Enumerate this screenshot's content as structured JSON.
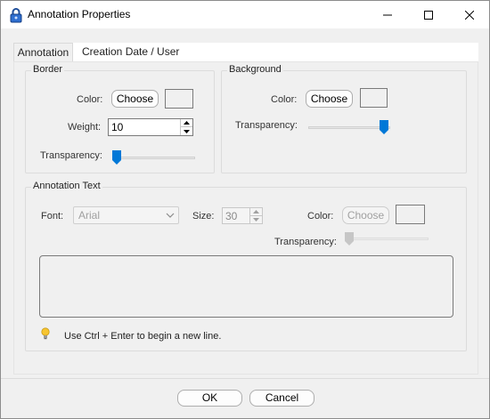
{
  "window": {
    "title": "Annotation Properties",
    "controls": {
      "minimize": "minimize",
      "maximize": "maximize",
      "close": "close"
    }
  },
  "tabs": [
    {
      "label": "Annotation",
      "active": true
    },
    {
      "label": "Creation Date / User Information",
      "active": false
    }
  ],
  "border": {
    "title": "Border",
    "color_label": "Color:",
    "choose_label": "Choose",
    "weight_label": "Weight:",
    "weight_value": "10",
    "transparency_label": "Transparency:",
    "transparency_level": 0.0
  },
  "background": {
    "title": "Background",
    "color_label": "Color:",
    "choose_label": "Choose",
    "transparency_label": "Transparency:",
    "transparency_level": 1.0
  },
  "annotation_text": {
    "title": "Annotation Text",
    "font_label": "Font:",
    "font_value": "Arial",
    "size_label": "Size:",
    "size_value": "30",
    "color_label": "Color:",
    "choose_label": "Choose",
    "transparency_label": "Transparency:",
    "transparency_level": 0.0,
    "text_value": "",
    "hint": "Use Ctrl + Enter to begin a new line."
  },
  "footer": {
    "ok_label": "OK",
    "cancel_label": "Cancel"
  },
  "colors": {
    "accent": "#0078d7",
    "title_bg": "#ffffff",
    "dialog_bg": "#f0f0f0"
  },
  "icons": {
    "app": "lock-icon",
    "hint": "lightbulb-icon"
  }
}
